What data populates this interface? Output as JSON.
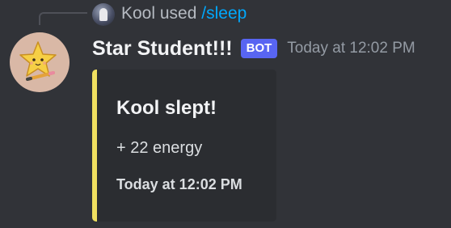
{
  "reply": {
    "user": "Kool",
    "verb": "used",
    "command": "/sleep"
  },
  "message": {
    "author": "Star Student!!!",
    "bot_tag": "BOT",
    "timestamp": "Today at 12:02 PM"
  },
  "embed": {
    "accent_color": "#f0e060",
    "title": "Kool slept!",
    "description": "+ 22 energy",
    "footer": "Today at 12:02 PM"
  },
  "icons": {
    "reply_avatar": "user-avatar-icon",
    "bot_avatar": "star-mascot-icon"
  }
}
